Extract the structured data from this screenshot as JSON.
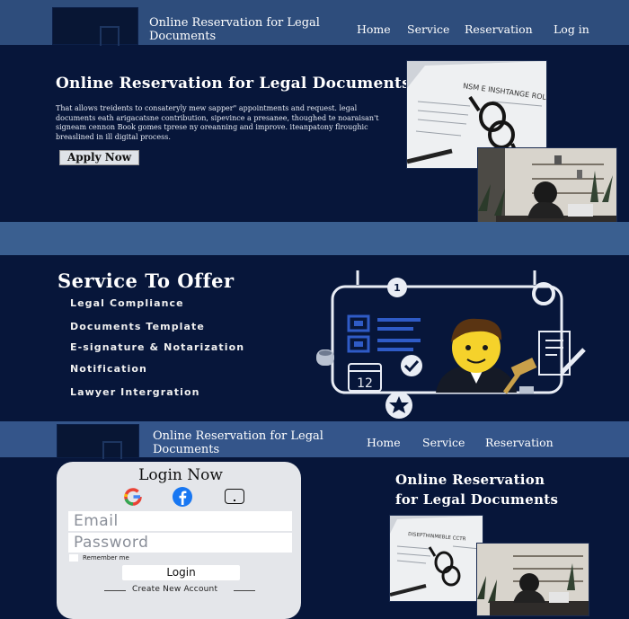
{
  "header": {
    "brand_line1": "Online Reservation for Legal",
    "brand_line2": "Documents",
    "nav": [
      "Home",
      "Service",
      "Reservation",
      "Log in"
    ]
  },
  "hero": {
    "title": "Online Reservation for Legal Documents",
    "description": "That allows treidents to consateryly mew sapper\" appointments and request. legal documents eath arigacatsne contribution, sipevince a presanee, thoughed te noaraisan't signeam cennon Book gomes tprese ny oreanning and improve. iteanpatony flroughic breaslined in ill digital process.",
    "apply_label": "Apply Now",
    "photo1_caption": "NSM E INSHTANGE ROLLE"
  },
  "services": {
    "title": "Service To Offer",
    "items": [
      "Legal Compliance",
      "Documents Template",
      "E-signature & Notarization",
      "Notification",
      "Lawyer Intergration"
    ],
    "badge_number": "1",
    "calendar_number": "12"
  },
  "second_header": {
    "brand_line1": "Online Reservation for Legal",
    "brand_line2": "Documents",
    "nav": [
      "Home",
      "Service",
      "Reservation"
    ]
  },
  "login": {
    "title": "Login Now",
    "email_placeholder": "Email",
    "password_placeholder": "Password",
    "remember_label": "Remember me",
    "login_label": "Login",
    "create_account_label": "Create New Account"
  },
  "right_panel": {
    "title_line1": "Online Reservation",
    "title_line2": "for Legal Documents",
    "photo_caption": "DISEPTHINMEBLE CCTR"
  },
  "colors": {
    "background": "#07163a",
    "header": "#2e4d7c",
    "band": "#3a5f90",
    "card": "#e4e6ea",
    "google_red": "#ea4335",
    "facebook_blue": "#1877f2"
  }
}
